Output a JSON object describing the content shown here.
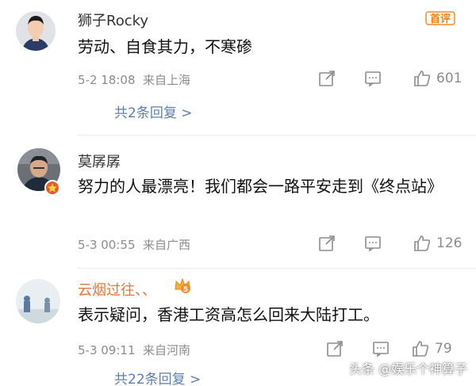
{
  "badge_first": "首评",
  "comments": [
    {
      "username": "狮子Rocky",
      "text": "劳动、自食其力，不寒碜",
      "date": "5-2 18:08",
      "location": "来自上海",
      "likes": "601",
      "replies": "共2条回复 >"
    },
    {
      "username": "莫孱孱",
      "text": "努力的人最漂亮！我们都会一路平安走到《终点站》",
      "date": "5-3 00:55",
      "location": "来自广西",
      "likes": "126",
      "replies": ""
    },
    {
      "username": "云烟过往、、",
      "text": "表示疑问，香港工资高怎么回来大陆打工。",
      "date": "5-3 09:11",
      "location": "来自河南",
      "likes": "79",
      "replies": "共22条回复 >",
      "user_level": "5"
    }
  ],
  "watermark": "头条 @娱乐个神算子",
  "colors": {
    "reply_link": "#5b7fae",
    "username_highlight": "#e8743b",
    "meta": "#8c8c8c"
  },
  "icons": [
    "share-icon",
    "comment-icon",
    "thumbs-up-icon",
    "first-comment-badge",
    "vip-badge",
    "crown-icon"
  ]
}
